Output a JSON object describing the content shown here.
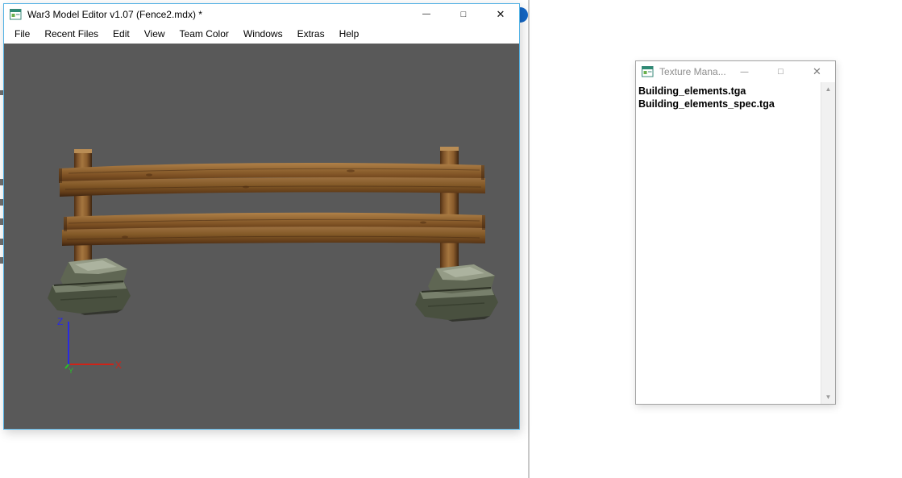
{
  "main_window": {
    "title": "War3 Model Editor v1.07 (Fence2.mdx) *",
    "window_controls": {
      "minimize": "—",
      "maximize": "□",
      "close": "✕"
    },
    "menu": [
      "File",
      "Recent Files",
      "Edit",
      "View",
      "Team Color",
      "Windows",
      "Extras",
      "Help"
    ],
    "viewport": {
      "axis_labels": {
        "x": "X",
        "y": "Y",
        "z": "Z"
      }
    }
  },
  "texture_manager": {
    "title": "Texture Mana...",
    "window_controls": {
      "minimize": "—",
      "maximize": "□",
      "close": "✕"
    },
    "items": [
      "Building_elements.tga",
      "Building_elements_spec.tga"
    ],
    "scrollbar": {
      "up": "▲",
      "down": "▼"
    }
  },
  "colors": {
    "viewport_background": "#595959",
    "active_window_border": "#55b2e4",
    "axis_x": "#cf2318",
    "axis_y": "#27c127",
    "axis_z": "#2a2ae0",
    "wood_mid": "#8a5a2e",
    "stone_mid": "#5c6253"
  }
}
